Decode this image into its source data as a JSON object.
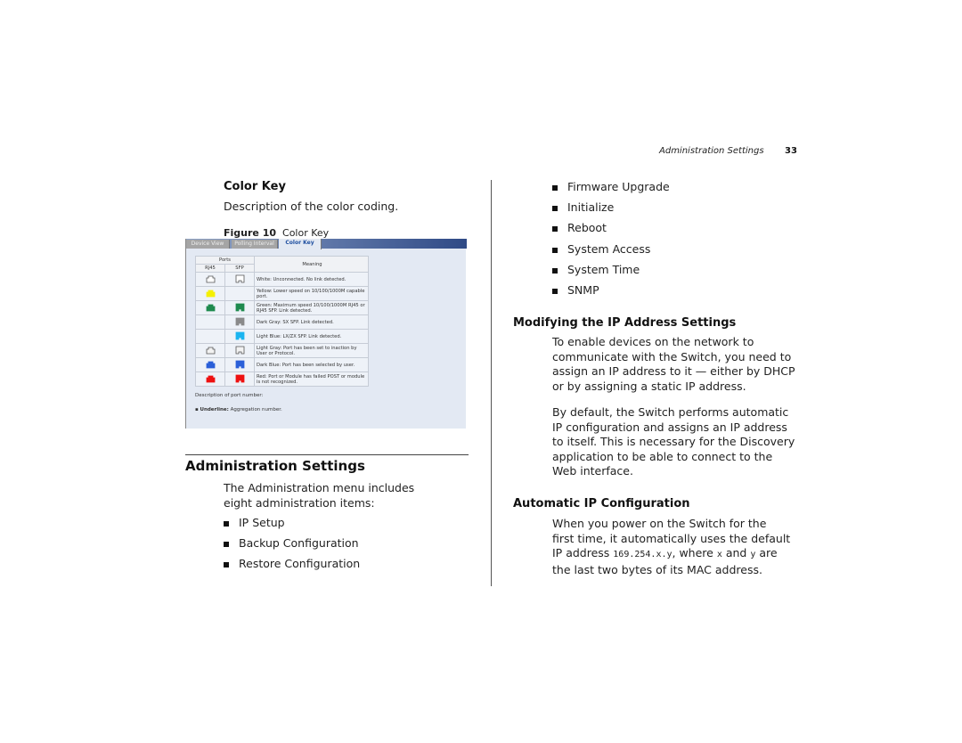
{
  "header": {
    "running_head": "Administration Settings",
    "page_number": "33"
  },
  "left": {
    "color_key_heading": "Color Key",
    "color_key_desc": "Description of the color coding.",
    "figure": {
      "label": "Figure 10",
      "title": "Color Key"
    },
    "screenshot": {
      "tabs": [
        {
          "label": "Device View",
          "active": false
        },
        {
          "label": "Polling Interval",
          "active": false
        },
        {
          "label": "Color Key",
          "active": true
        }
      ],
      "table_headers": {
        "ports": "Ports",
        "rj45": "RJ45",
        "sfp": "SFP",
        "meaning": "Meaning"
      },
      "rows": [
        {
          "rj45": "white",
          "sfp": "white",
          "meaning": "White: Unconnected. No link detected."
        },
        {
          "rj45": "yellow",
          "sfp": null,
          "meaning": "Yellow: Lower speed on 10/100/1000M capable port."
        },
        {
          "rj45": "green",
          "sfp": "green",
          "meaning": "Green: Maximum speed 10/100/1000M RJ45 or RJ45 SFP. Link detected."
        },
        {
          "rj45": null,
          "sfp": "darkgray",
          "meaning": "Dark Gray: SX SFP. Link detected."
        },
        {
          "rj45": null,
          "sfp": "lightblue",
          "meaning": "Light Blue: LX/ZX SFP. Link detected."
        },
        {
          "rj45": "lightgray",
          "sfp": "lightgray",
          "meaning": "Light Gray: Port has been set to inaction by User or Protocol."
        },
        {
          "rj45": "darkblue",
          "sfp": "darkblue",
          "meaning": "Dark Blue: Port has been selected by user."
        },
        {
          "rj45": "red",
          "sfp": "red",
          "meaning": "Red: Port or Module has failed POST or module is not recognized."
        }
      ],
      "colors": {
        "white": "#ffffff",
        "yellow": "#f5f000",
        "green": "#1e8a4e",
        "darkgray": "#8a8a8a",
        "lightblue": "#1ab4f0",
        "lightgray": "#f2f2f2",
        "darkblue": "#2a5fd8",
        "red": "#ee1010"
      },
      "port_desc": "Description of port number:",
      "underline_label": "Underline:",
      "underline_text": "Aggregation number."
    },
    "admin_heading": "Administration Settings",
    "admin_intro": "The Administration menu includes eight administration items:",
    "admin_items": [
      "IP Setup",
      "Backup Configuration",
      "Restore Configuration"
    ]
  },
  "right": {
    "admin_items": [
      "Firmware Upgrade",
      "Initialize",
      "Reboot",
      "System Access",
      "System Time",
      "SNMP"
    ],
    "modify_heading": "Modifying the IP Address Settings",
    "modify_p1": "To enable devices on the network to communicate with the Switch, you need to assign an IP address to it — either by DHCP or by assigning a static IP address.",
    "modify_p2": "By default, the Switch performs automatic IP configuration and assigns an IP address to itself. This is necessary for the Discovery application to be able to connect to the Web interface.",
    "auto_heading": "Automatic IP Configuration",
    "auto_p_before": "When you power on the Switch for the first time, it automatically uses the default IP address ",
    "auto_code_ip": "169.254.x.y",
    "auto_p_mid1": ", where ",
    "auto_code_x": "x",
    "auto_p_mid2": " and ",
    "auto_code_y": "y",
    "auto_p_after": " are the last two bytes of its MAC address."
  }
}
